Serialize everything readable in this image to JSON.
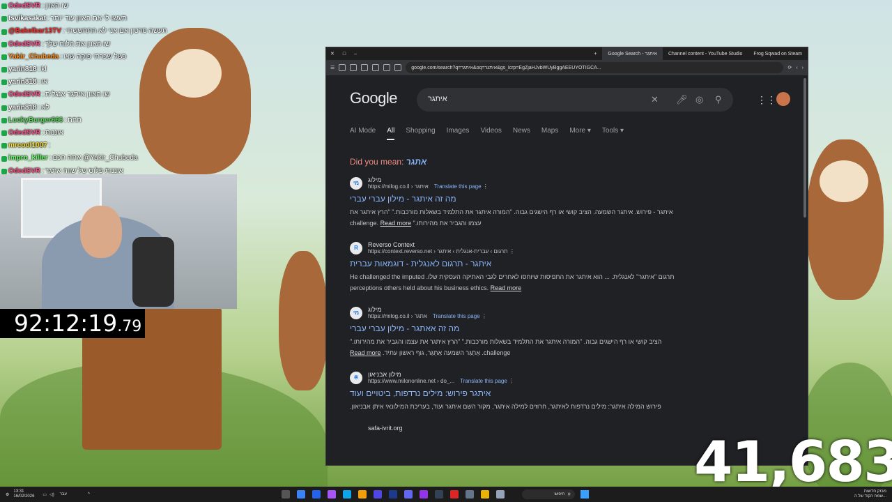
{
  "chat": [
    {
      "user": "OdedSVR",
      "color": "#ff4d8a",
      "msg": "שו האוון"
    },
    {
      "user": "tsvikasakat",
      "color": "#ffffff",
      "msg": "תעשו לי את האוון עוד יותר"
    },
    {
      "user": "@Bakelbar13TV",
      "color": "#ff2d2d",
      "msg": "תעשה סרטון אם אני לא התחששתי"
    },
    {
      "user": "OdedSVR",
      "color": "#ff4d8a",
      "msg": "שו האוון את הלוח שלך"
    },
    {
      "user": "Yakir_Chubeda",
      "color": "#ff8c1a",
      "msg": "כשל שכרתי פוקה שאו"
    },
    {
      "user": "yarin818",
      "color": "#ffffff",
      "msg": "kl"
    },
    {
      "user": "yarin818",
      "color": "#ffffff",
      "msg": "או"
    },
    {
      "user": "OdedSVR",
      "color": "#ff4d8a",
      "msg": "שו האוון איתגר אנגלית"
    },
    {
      "user": "yarin818",
      "color": "#ffffff",
      "msg": "לא"
    },
    {
      "user": "LuckyBurger666",
      "color": "#5dd65d",
      "msg": "חחח"
    },
    {
      "user": "OdedSVR",
      "color": "#ff4d8a",
      "msg": "אוננות"
    },
    {
      "user": "mrcool1007",
      "color": "#ffdd33",
      "msg": ""
    },
    {
      "user": "impro_killer",
      "color": "#66ff66",
      "msg": "אתה חכם @Yakir_Chubeda"
    },
    {
      "user": "OdedSVR",
      "color": "#ff4d8a",
      "msg": "אוננות פלוס של שווה אתגר"
    }
  ],
  "timer": {
    "main": "92:12:19",
    "fraction": ".79"
  },
  "sub_count": "41,683",
  "browser": {
    "tabs": [
      {
        "label": "Google Search - איתגר",
        "active": true
      },
      {
        "label": "Channel content - YouTube Studio",
        "active": false
      },
      {
        "label": "Frog Sqwad on Steam",
        "active": false
      }
    ],
    "url": "google.com/search?q=איתגר&oq=איתגר&gs_lcrp=EgZjaHJvbWUyBggAEEUYOTIGCA..."
  },
  "google": {
    "logo": "Google",
    "query": "איתגר",
    "nav": [
      "AI Mode",
      "All",
      "Shopping",
      "Images",
      "Videos",
      "News",
      "Maps",
      "More ▾",
      "Tools ▾"
    ],
    "active_nav": "All",
    "did_you_mean_label": "Did you mean:",
    "did_you_mean_term": "אתגר",
    "results": [
      {
        "favicon": "מי",
        "site": "מילוג",
        "url": "https://milog.co.il › איתגר",
        "translate": "Translate this page",
        "title": "מה זה איתגר - מילון עברי עברי",
        "snippet": "איתגר - פירוש. איתגר השמעה. הציב קושי או רף הישגים גבוה. \"המורה איתגר את התלמיד בשאלות מורכבות.\" \"הרץ איתגר את עצמו והגביר את מהירותו.\" challenge.",
        "more": "Read more"
      },
      {
        "favicon": "R",
        "site": "Reverso Context",
        "url": "https://context.reverso.net › תרגום › עברית-אנגלית › איתגר",
        "translate": "",
        "title": "איתגר - תרגום לאנגלית - דוגמאות עברית",
        "snippet": "תרגום \"איתגר\" לאנגלית. ... הוא איתגר את התפיסות שיוחסו לאחרים לגבי האתיקה העסקית שלו. He challenged the imputed perceptions others held about his business ethics.",
        "more": "Read more"
      },
      {
        "favicon": "מי",
        "site": "מילוג",
        "url": "https://milog.co.il › אתגר",
        "translate": "Translate this page",
        "title": "מה זה אאתגר - מילון עברי עברי",
        "snippet": "הציב קושי או רף הישגים גבוה. \"המורה איתגר את התלמיד בשאלות מורכבות.\" \"הרץ איתגר את עצמו והגביר את מהירותו.\" challenge. אַתְגַּר השמעה אַתְגַּר, גוף ראשון עתיד.",
        "more": "Read more"
      },
      {
        "favicon": "※",
        "site": "מילון אבניאון",
        "url": "https://www.milononline.net › do_...",
        "translate": "Translate this page",
        "title": "איתגר פירוש: מילים נרדפות, ביטויים ועוד",
        "snippet": "פירוש המילה איתגר: מילים נרדפות לאיתגר, חרוזים למילה איתגר, מקור השם איתגר ועוד, בעריכת המילונאי איתן אבניאון.",
        "more": ""
      }
    ],
    "next_site": "safa-ivrit.org"
  },
  "taskbar": {
    "time": "13:31",
    "date": "16/02/2026",
    "lang": "עבר",
    "search_placeholder": "חיפוש",
    "news_title": "מבזק חדשות",
    "news_sub": "שמח הקוד של ה..."
  }
}
